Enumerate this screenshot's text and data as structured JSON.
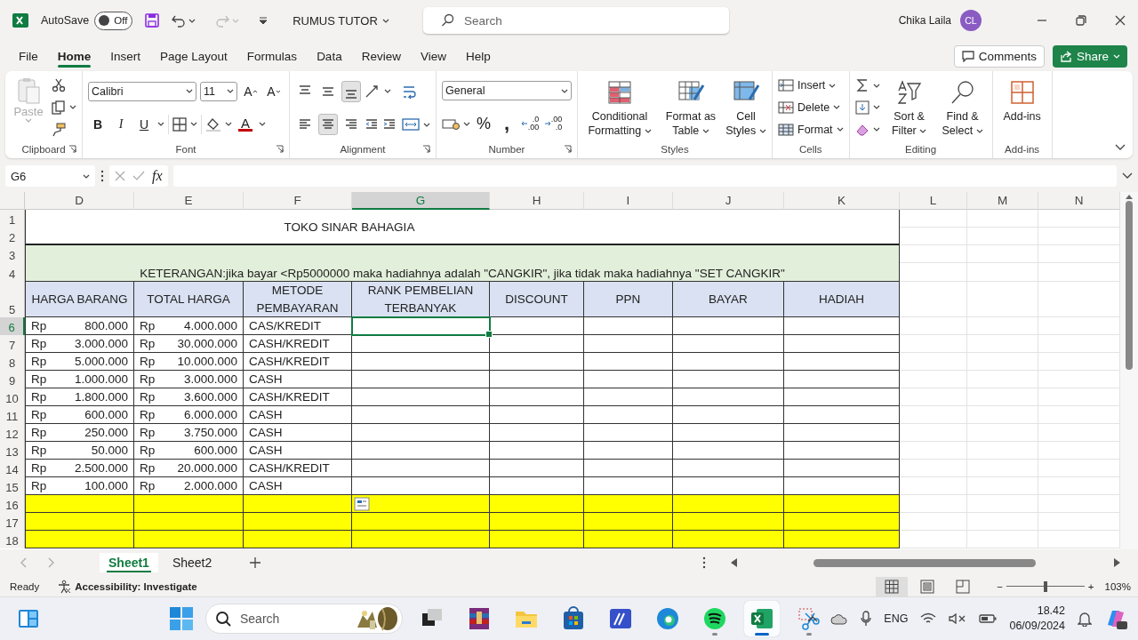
{
  "title_bar": {
    "autosave_label": "AutoSave",
    "autosave": {
      "on": false,
      "label": "Off"
    },
    "document_title": "RUMUS TUTOR",
    "search": {
      "placeholder": "Search"
    },
    "user_name": "Chika Laila",
    "user_initials": "CL"
  },
  "ribbon_tabs": [
    {
      "label": "File",
      "selected": false
    },
    {
      "label": "Home",
      "selected": true
    },
    {
      "label": "Insert",
      "selected": false
    },
    {
      "label": "Page Layout",
      "selected": false
    },
    {
      "label": "Formulas",
      "selected": false
    },
    {
      "label": "Data",
      "selected": false
    },
    {
      "label": "Review",
      "selected": false
    },
    {
      "label": "View",
      "selected": false
    },
    {
      "label": "Help",
      "selected": false
    }
  ],
  "ribbon_actions": [
    {
      "kind": "comments",
      "label": "Comments"
    },
    {
      "kind": "share",
      "label": "Share"
    }
  ],
  "ribbon": {
    "groups": [
      {
        "kind": "clipboard",
        "label": "Clipboard",
        "paste": {
          "label": "Paste",
          "disabled": true
        }
      },
      {
        "kind": "font",
        "label": "Font",
        "font_name": "Calibri",
        "font_size": "11",
        "grow": "A",
        "shrink": "A",
        "styles": [
          "B",
          "I",
          "U"
        ],
        "font_color": "A"
      },
      {
        "kind": "alignment",
        "label": "Alignment",
        "vertical": [
          {
            "selected": false
          },
          {
            "selected": false
          },
          {
            "selected": true
          }
        ],
        "horizontal": [
          {
            "selected": false
          },
          {
            "selected": true
          },
          {
            "selected": false
          }
        ]
      },
      {
        "kind": "number",
        "label": "Number",
        "format": "General",
        "percent": "%",
        "comma": ",",
        "decimals": [
          {
            "top": ".0",
            "bottom": ".00"
          },
          {
            "top": ".00",
            "bottom": ".0"
          }
        ]
      },
      {
        "kind": "styles",
        "label": "Styles",
        "buttons": [
          {
            "kind": "conditional",
            "label": "Conditional Formatting"
          },
          {
            "kind": "table",
            "label": "Format as Table"
          },
          {
            "kind": "cellstyles",
            "label": "Cell Styles"
          }
        ]
      },
      {
        "kind": "cells",
        "label": "Cells",
        "buttons": [
          {
            "kind": "insert",
            "label": "Insert"
          },
          {
            "kind": "delete",
            "label": "Delete"
          },
          {
            "kind": "format",
            "label": "Format"
          }
        ]
      },
      {
        "kind": "editing",
        "label": "Editing",
        "buttons": [
          {
            "kind": "sort",
            "label": "Sort & Filter"
          },
          {
            "kind": "find",
            "label": "Find & Select"
          }
        ]
      },
      {
        "kind": "addins",
        "label": "Add-ins",
        "buttons": [
          {
            "kind": "addins",
            "label": "Add-ins"
          }
        ]
      }
    ]
  },
  "formula_bar": {
    "name_box": "G6",
    "function_label": "fx"
  },
  "sheet": {
    "columns": [
      {
        "label": "D",
        "selected": false
      },
      {
        "label": "E",
        "selected": false
      },
      {
        "label": "F",
        "selected": false
      },
      {
        "label": "G",
        "selected": true
      },
      {
        "label": "H",
        "selected": false
      },
      {
        "label": "I",
        "selected": false
      },
      {
        "label": "J",
        "selected": false
      },
      {
        "label": "K",
        "selected": false
      },
      {
        "label": "L",
        "selected": false
      },
      {
        "label": "M",
        "selected": false
      },
      {
        "label": "N",
        "selected": false
      }
    ],
    "row_numbers": [
      {
        "label": "1",
        "selected": false
      },
      {
        "label": "2",
        "selected": false
      },
      {
        "label": "3",
        "selected": false
      },
      {
        "label": "4",
        "selected": false
      },
      {
        "label": "5",
        "selected": false
      },
      {
        "label": "6",
        "selected": true
      },
      {
        "label": "7",
        "selected": false
      },
      {
        "label": "8",
        "selected": false
      },
      {
        "label": "9",
        "selected": false
      },
      {
        "label": "10",
        "selected": false
      },
      {
        "label": "11",
        "selected": false
      },
      {
        "label": "12",
        "selected": false
      },
      {
        "label": "13",
        "selected": false
      },
      {
        "label": "14",
        "selected": false
      },
      {
        "label": "15",
        "selected": false
      },
      {
        "label": "16",
        "selected": false
      },
      {
        "label": "17",
        "selected": false
      },
      {
        "label": "18",
        "selected": false
      }
    ],
    "title": "TOKO SINAR BAHAGIA",
    "note": "KETERANGAN:jika bayar <Rp5000000 maka hadiahnya adalah \"CANGKIR\", jika tidak maka hadiahnya \"SET CANGKIR\"",
    "headers": [
      "HARGA BARANG",
      "TOTAL HARGA",
      "METODE PEMBAYARAN",
      "RANK PEMBELIAN TERBANYAK",
      "DISCOUNT",
      "PPN",
      "BAYAR",
      "HADIAH"
    ],
    "rows": [
      {
        "kind": "data",
        "currency_1": "Rp",
        "price": "800.000",
        "currency_2": "Rp",
        "total": "4.000.000",
        "method": "CAS/KREDIT"
      },
      {
        "kind": "data",
        "currency_1": "Rp",
        "price": "3.000.000",
        "currency_2": "Rp",
        "total": "30.000.000",
        "method": "CASH/KREDIT"
      },
      {
        "kind": "data",
        "currency_1": "Rp",
        "price": "5.000.000",
        "currency_2": "Rp",
        "total": "10.000.000",
        "method": "CASH/KREDIT"
      },
      {
        "kind": "data",
        "currency_1": "Rp",
        "price": "1.000.000",
        "currency_2": "Rp",
        "total": "3.000.000",
        "method": "CASH"
      },
      {
        "kind": "data",
        "currency_1": "Rp",
        "price": "1.800.000",
        "currency_2": "Rp",
        "total": "3.600.000",
        "method": "CASH/KREDIT"
      },
      {
        "kind": "data",
        "currency_1": "Rp",
        "price": "600.000",
        "currency_2": "Rp",
        "total": "6.000.000",
        "method": "CASH"
      },
      {
        "kind": "data",
        "currency_1": "Rp",
        "price": "250.000",
        "currency_2": "Rp",
        "total": "3.750.000",
        "method": "CASH"
      },
      {
        "kind": "data",
        "currency_1": "Rp",
        "price": "50.000",
        "currency_2": "Rp",
        "total": "600.000",
        "method": "CASH"
      },
      {
        "kind": "data",
        "currency_1": "Rp",
        "price": "2.500.000",
        "currency_2": "Rp",
        "total": "20.000.000",
        "method": "CASH/KREDIT"
      },
      {
        "kind": "data",
        "currency_1": "Rp",
        "price": "100.000",
        "currency_2": "Rp",
        "total": "2.000.000",
        "method": "CASH"
      },
      {
        "kind": "blank",
        "color": "#ffff00"
      },
      {
        "kind": "blank",
        "color": "#ffff00"
      },
      {
        "kind": "blank",
        "color": "#ffff00"
      }
    ]
  },
  "sheet_tabs": [
    {
      "label": "Sheet1",
      "selected": true
    },
    {
      "label": "Sheet2",
      "selected": false
    }
  ],
  "status_bar": {
    "status": "Ready",
    "accessibility": "Accessibility: Investigate",
    "views": [
      {
        "kind": "normal",
        "selected": true
      },
      {
        "kind": "page_layout",
        "selected": false
      },
      {
        "kind": "page_break",
        "selected": false
      }
    ],
    "zoom_out": "−",
    "zoom": {
      "level": 0.5
    },
    "zoom_in": "+",
    "zoom_label": "103%"
  },
  "taskbar": {
    "search": {
      "placeholder": "Search"
    },
    "apps": [
      {
        "kind": "taskview",
        "running": false,
        "selected": false
      },
      {
        "kind": "archive",
        "running": false,
        "selected": false
      },
      {
        "kind": "folder",
        "running": false,
        "selected": false
      },
      {
        "kind": "store",
        "running": false,
        "selected": false
      },
      {
        "kind": "editor",
        "running": false,
        "selected": false
      },
      {
        "kind": "edge",
        "running": false,
        "selected": false
      },
      {
        "kind": "spotify",
        "running": true,
        "selected": false
      },
      {
        "kind": "excel",
        "running": true,
        "selected": true
      },
      {
        "kind": "snip",
        "running": true,
        "selected": false
      }
    ],
    "language": "ENG",
    "time": "18.42",
    "date": "06/09/2024"
  }
}
